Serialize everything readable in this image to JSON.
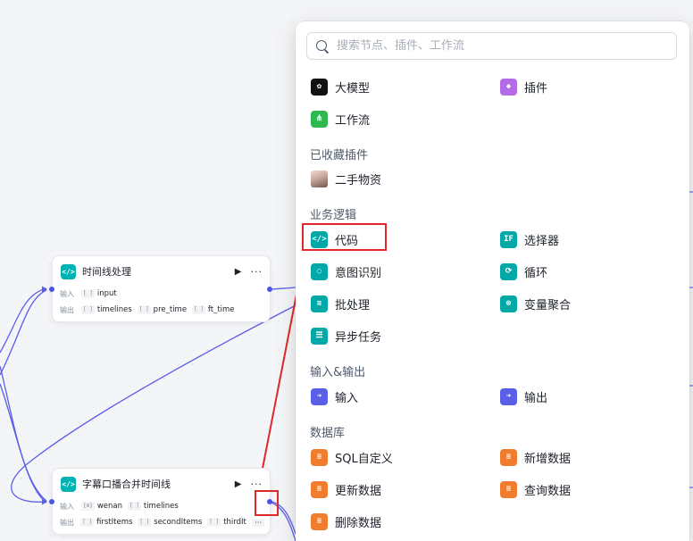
{
  "canvas": {
    "background_color": "#f4f5f7",
    "edge_color": "#5b5fe8",
    "annotation_color": "#e0282a"
  },
  "nodes": [
    {
      "title": "时间线处理",
      "icon": "code-icon",
      "run_icon": "▶",
      "more_icon": "···",
      "input_label": "输入",
      "inputs": [
        {
          "type": "[ ]",
          "name": "input"
        }
      ],
      "output_label": "输出",
      "outputs": [
        {
          "type": "[ ]",
          "name": "timelines"
        },
        {
          "type": "[ ]",
          "name": "pre_time"
        },
        {
          "type": "[ ]",
          "name": "ft_time"
        }
      ]
    },
    {
      "title": "字幕口播合并时间线",
      "icon": "code-icon",
      "run_icon": "▶",
      "more_icon": "···",
      "input_label": "输入",
      "inputs": [
        {
          "type": "{m}",
          "name": "wenan"
        },
        {
          "type": "[ ]",
          "name": "timelines"
        }
      ],
      "output_label": "输出",
      "outputs": [
        {
          "type": "[ ]",
          "name": "firstItems"
        },
        {
          "type": "[ ]",
          "name": "secondItems"
        },
        {
          "type": "[ ]",
          "name": "thirdIten"
        }
      ],
      "outputs_more": "···"
    }
  ],
  "picker": {
    "search_placeholder": "搜索节点、插件、工作流",
    "top_items": [
      {
        "label": "大模型",
        "icon": "llm-icon"
      },
      {
        "label": "插件",
        "icon": "plugin-cube-icon"
      },
      {
        "label": "工作流",
        "icon": "workflow-icon"
      }
    ],
    "sections": {
      "saved_plugins": {
        "title": "已收藏插件",
        "items": [
          {
            "label": "二手物资",
            "icon": "avatar-image-icon"
          }
        ]
      },
      "business_logic": {
        "title": "业务逻辑",
        "items": [
          {
            "label": "代码",
            "icon": "code-icon"
          },
          {
            "label": "选择器",
            "icon": "if-selector-icon",
            "glyph": "IF"
          },
          {
            "label": "意图识别",
            "icon": "intent-bulb-icon"
          },
          {
            "label": "循环",
            "icon": "loop-icon"
          },
          {
            "label": "批处理",
            "icon": "batch-layers-icon"
          },
          {
            "label": "变量聚合",
            "icon": "variable-aggregate-icon"
          },
          {
            "label": "异步任务",
            "icon": "async-task-icon"
          }
        ]
      },
      "io": {
        "title": "输入&输出",
        "items": [
          {
            "label": "输入",
            "icon": "input-arrow-icon"
          },
          {
            "label": "输出",
            "icon": "output-arrow-icon"
          }
        ]
      },
      "database": {
        "title": "数据库",
        "items": [
          {
            "label": "SQL自定义",
            "icon": "database-sql-icon"
          },
          {
            "label": "新增数据",
            "icon": "database-add-icon"
          },
          {
            "label": "更新数据",
            "icon": "database-update-icon"
          },
          {
            "label": "查询数据",
            "icon": "database-query-icon"
          },
          {
            "label": "删除数据",
            "icon": "database-delete-icon"
          }
        ]
      }
    }
  }
}
